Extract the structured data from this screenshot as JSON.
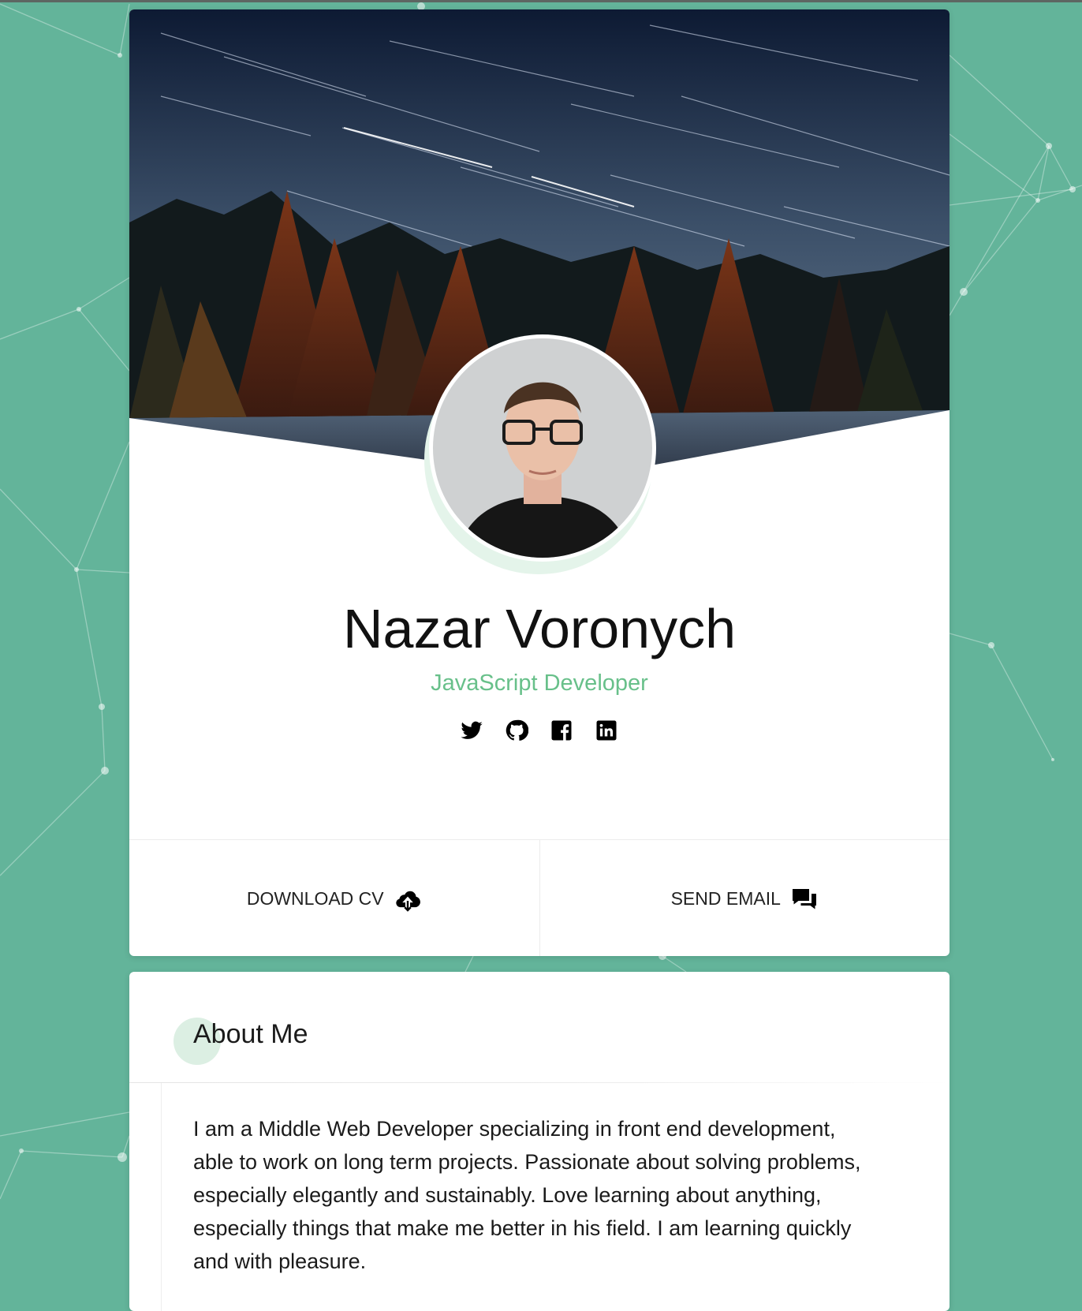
{
  "profile": {
    "name": "Nazar Voronych",
    "role": "JavaScript Developer",
    "socials": [
      {
        "icon": "twitter-icon"
      },
      {
        "icon": "github-icon"
      },
      {
        "icon": "facebook-icon"
      },
      {
        "icon": "linkedin-icon"
      }
    ]
  },
  "actions": {
    "download_label": "DOWNLOAD CV",
    "download_icon": "cloud-download-icon",
    "email_label": "SEND EMAIL",
    "email_icon": "chat-bubbles-icon"
  },
  "about": {
    "title": "About Me",
    "text": "I am a Middle Web Developer specializing in front end development, able to work on long term projects. Passionate about solving problems, especially elegantly and sustainably. Love learning about anything, especially things that make me better in his field. I am learning quickly and with pleasure."
  },
  "colors": {
    "background": "#63b49a",
    "accent": "#68c08a",
    "card": "#ffffff"
  }
}
